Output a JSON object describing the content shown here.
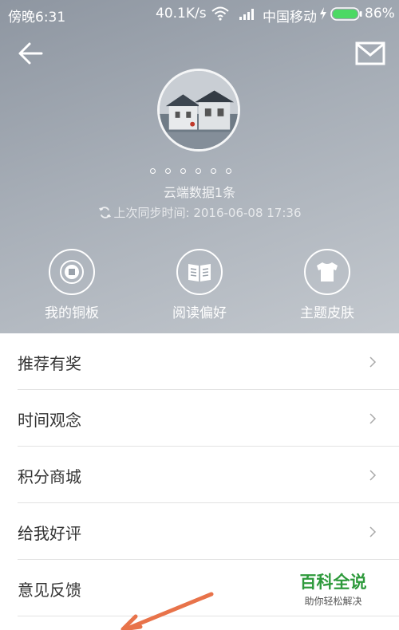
{
  "status_bar": {
    "time": "傍晚6:31",
    "net_speed": "40.1K/s",
    "carrier": "中国移动",
    "battery_percent": "86%",
    "battery_level": 0.86
  },
  "header": {
    "back_icon": "back-arrow-icon",
    "mail_icon": "mail-icon",
    "cloud_data": "云端数据1条",
    "last_sync": "上次同步时间: 2016-06-08 17:36"
  },
  "features": [
    {
      "label": "我的铜板",
      "icon": "coin-icon"
    },
    {
      "label": "阅读偏好",
      "icon": "book-icon"
    },
    {
      "label": "主题皮肤",
      "icon": "shirt-icon"
    }
  ],
  "menu": [
    {
      "label": "推荐有奖"
    },
    {
      "label": "时间观念"
    },
    {
      "label": "积分商城"
    },
    {
      "label": "给我好评"
    },
    {
      "label": "意见反馈"
    }
  ],
  "watermark": {
    "title": "百科全说",
    "subtitle": "助你轻松解决"
  },
  "colors": {
    "header_gradient_start": "#8e96a1",
    "header_gradient_end": "#c3c8ce",
    "battery_green": "#4cd964",
    "watermark_green": "#2e9a3c",
    "arrow_orange": "#e8734a"
  }
}
